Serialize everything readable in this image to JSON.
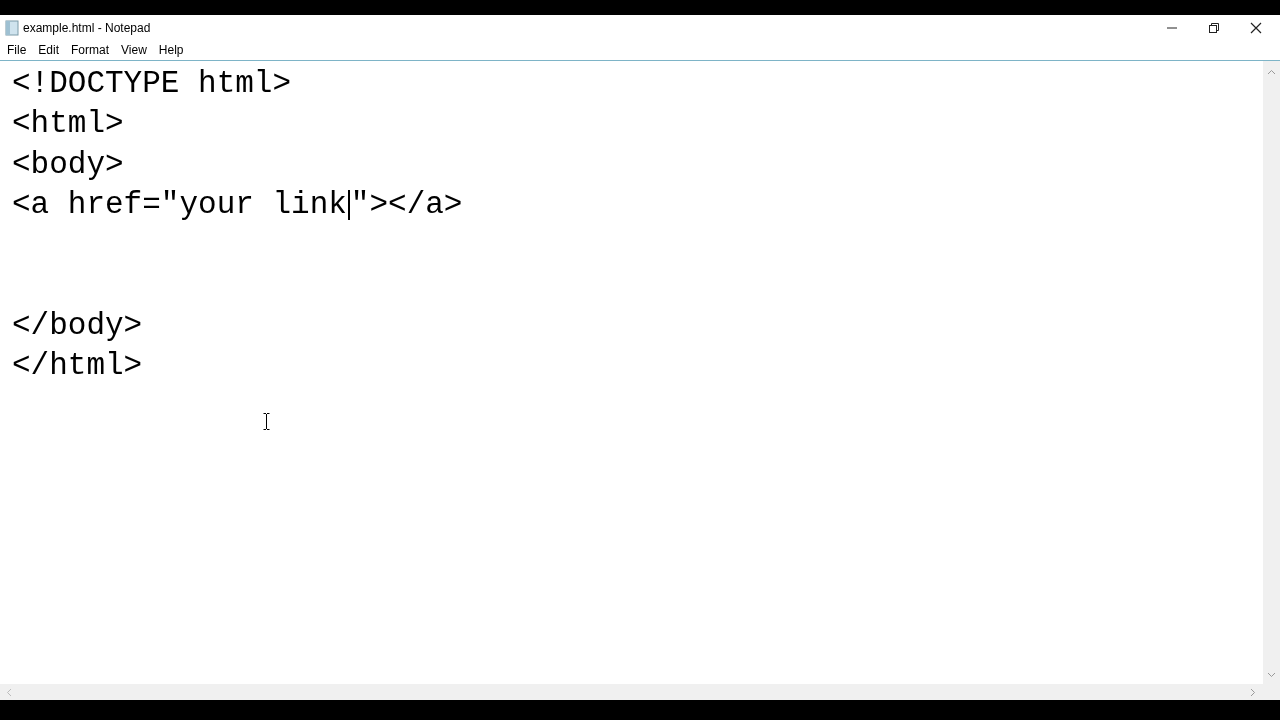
{
  "window": {
    "title": "example.html - Notepad"
  },
  "menu": [
    "File",
    "Edit",
    "Format",
    "View",
    "Help"
  ],
  "editor": {
    "lines": [
      {
        "kind": "text",
        "text": "<!DOCTYPE html>"
      },
      {
        "kind": "text",
        "text": "<html>"
      },
      {
        "kind": "text",
        "text": "<body>"
      },
      {
        "kind": "caret",
        "before_caret": "<a href=\"your link",
        "after_caret": "\"></a>"
      },
      {
        "kind": "blank"
      },
      {
        "kind": "blank"
      },
      {
        "kind": "text",
        "text": "</body>"
      },
      {
        "kind": "text",
        "text": "</html>"
      }
    ]
  }
}
